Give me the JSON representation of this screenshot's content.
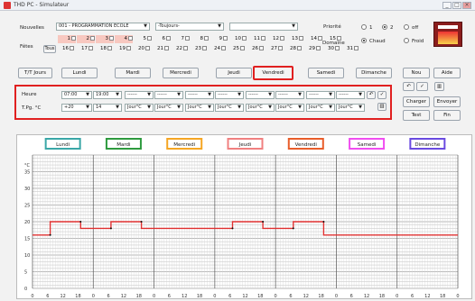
{
  "window": {
    "title": "THD PC - Simulateur",
    "buttons": [
      "_",
      "□",
      "×"
    ]
  },
  "program": {
    "label": "Nouvelles",
    "program_select": "001 - PROGRAMMATION ECOLE",
    "repeat_select": "-Toujours-",
    "empty_select": "",
    "periods_label": "Fêtes",
    "all_button": "Tous",
    "day_numbers": [
      "1",
      "2",
      "3",
      "4",
      "5",
      "6",
      "7",
      "8",
      "9",
      "10",
      "11",
      "12",
      "13",
      "14",
      "15",
      "16",
      "17",
      "18",
      "19",
      "20",
      "21",
      "22",
      "23",
      "24",
      "25",
      "26",
      "27",
      "28",
      "29",
      "30",
      "31"
    ]
  },
  "options": {
    "priority_label": "Priorité",
    "priority_opts": [
      "1",
      "2",
      "off"
    ],
    "priority_selected": "2",
    "domain_label": "Domaine",
    "domain_opts": [
      "Chaud",
      "Froid"
    ],
    "domain_selected": "Chaud"
  },
  "tabs": {
    "all": "T/T Jours",
    "days": [
      "Lundi",
      "Mardi",
      "Mercredi",
      "Jeudi",
      "Vendredi",
      "Samedi",
      "Dimanche"
    ],
    "selected": "Vendredi"
  },
  "edit": {
    "hour_label": "Heure",
    "temp_label": "T.Pg. °C",
    "hours": [
      "07:00",
      "19:00",
      "------",
      "------",
      "------",
      "------",
      "------",
      "------",
      "------",
      "------"
    ],
    "temps": [
      "+20",
      "14",
      "Jour°C",
      "Jour°C",
      "Jour°C",
      "Jour°C",
      "Jour°C",
      "Jour°C",
      "Jour°C",
      "Jour°C"
    ]
  },
  "right_buttons": {
    "new": "Nou",
    "help": "Aide",
    "load": "Charger",
    "send": "Envoyer",
    "test": "Test",
    "end": "Fin"
  },
  "chart_data": {
    "type": "line",
    "day_labels": [
      "Lundi",
      "Mardi",
      "Mercredi",
      "Jeudi",
      "Vendredi",
      "Samedi",
      "Dimanche"
    ],
    "day_colors": [
      "#3aa7a7",
      "#2e9a3e",
      "#f5a623",
      "#f08080",
      "#e85d2a",
      "#f04ef0",
      "#6a4ae0"
    ],
    "xticks": [
      "0",
      "6",
      "12",
      "18"
    ],
    "ylabel": "°C",
    "yticks": [
      "35",
      "30",
      "25",
      "20",
      "15",
      "10",
      "5",
      "0"
    ],
    "ylim": [
      0,
      40
    ],
    "series": [
      {
        "color": "#e03030",
        "points": [
          [
            0,
            16
          ],
          [
            0.2917,
            16
          ],
          [
            0.2917,
            20
          ],
          [
            0.7917,
            20
          ],
          [
            0.7917,
            18
          ],
          [
            1.2917,
            18
          ],
          [
            1.2917,
            20
          ],
          [
            1.7917,
            20
          ],
          [
            1.7917,
            18
          ],
          [
            3.2917,
            18
          ],
          [
            3.2917,
            20
          ],
          [
            3.7917,
            20
          ],
          [
            3.7917,
            18
          ],
          [
            4.2917,
            18
          ],
          [
            4.2917,
            20
          ],
          [
            4.7917,
            20
          ],
          [
            4.7917,
            16
          ],
          [
            7,
            16
          ]
        ]
      }
    ]
  }
}
